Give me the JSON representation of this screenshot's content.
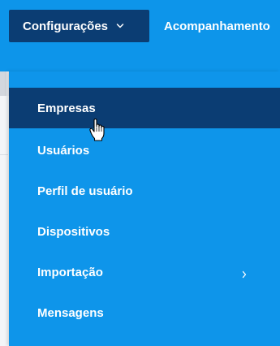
{
  "topbar": {
    "config_label": "Configurações",
    "nav_label": "Acompanhamento"
  },
  "menu": {
    "items": [
      {
        "label": "Empresas",
        "active": true
      },
      {
        "label": "Usuários"
      },
      {
        "label": "Perfil de usuário"
      },
      {
        "label": "Dispositivos"
      },
      {
        "label": "Importação",
        "has_submenu": true
      },
      {
        "label": "Mensagens"
      }
    ]
  },
  "colors": {
    "brand_blue": "#0d95ea",
    "dark_navy": "#0b3d73"
  },
  "icons": {
    "dropdown": "chevron-down-icon",
    "submenu": "chevron-right-icon",
    "cursor": "hand-pointer-cursor-icon"
  }
}
